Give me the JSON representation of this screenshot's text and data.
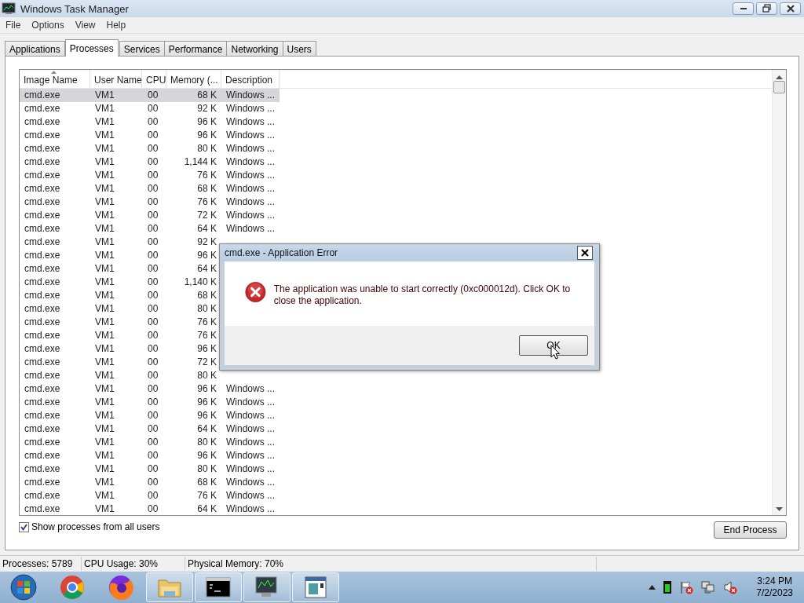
{
  "window": {
    "title": "Windows Task Manager"
  },
  "menu": [
    "File",
    "Options",
    "View",
    "Help"
  ],
  "tabs": [
    {
      "label": "Applications",
      "selected": false
    },
    {
      "label": "Processes",
      "selected": true
    },
    {
      "label": "Services",
      "selected": false
    },
    {
      "label": "Performance",
      "selected": false
    },
    {
      "label": "Networking",
      "selected": false
    },
    {
      "label": "Users",
      "selected": false
    }
  ],
  "table": {
    "columns": [
      "Image Name",
      "User Name",
      "CPU",
      "Memory (...",
      "Description"
    ],
    "rows": [
      {
        "image_name": "cmd.exe",
        "user_name": "VM1",
        "cpu": "00",
        "memory": "68 K",
        "description": "Windows ...",
        "selected": true
      },
      {
        "image_name": "cmd.exe",
        "user_name": "VM1",
        "cpu": "00",
        "memory": "92 K",
        "description": "Windows ...",
        "selected": false
      },
      {
        "image_name": "cmd.exe",
        "user_name": "VM1",
        "cpu": "00",
        "memory": "96 K",
        "description": "Windows ...",
        "selected": false
      },
      {
        "image_name": "cmd.exe",
        "user_name": "VM1",
        "cpu": "00",
        "memory": "96 K",
        "description": "Windows ...",
        "selected": false
      },
      {
        "image_name": "cmd.exe",
        "user_name": "VM1",
        "cpu": "00",
        "memory": "80 K",
        "description": "Windows ...",
        "selected": false
      },
      {
        "image_name": "cmd.exe",
        "user_name": "VM1",
        "cpu": "00",
        "memory": "1,144 K",
        "description": "Windows ...",
        "selected": false
      },
      {
        "image_name": "cmd.exe",
        "user_name": "VM1",
        "cpu": "00",
        "memory": "76 K",
        "description": "Windows ...",
        "selected": false
      },
      {
        "image_name": "cmd.exe",
        "user_name": "VM1",
        "cpu": "00",
        "memory": "68 K",
        "description": "Windows ...",
        "selected": false
      },
      {
        "image_name": "cmd.exe",
        "user_name": "VM1",
        "cpu": "00",
        "memory": "76 K",
        "description": "Windows ...",
        "selected": false
      },
      {
        "image_name": "cmd.exe",
        "user_name": "VM1",
        "cpu": "00",
        "memory": "72 K",
        "description": "Windows ...",
        "selected": false
      },
      {
        "image_name": "cmd.exe",
        "user_name": "VM1",
        "cpu": "00",
        "memory": "64 K",
        "description": "Windows ...",
        "selected": false
      },
      {
        "image_name": "cmd.exe",
        "user_name": "VM1",
        "cpu": "00",
        "memory": "92 K",
        "selected": false
      },
      {
        "image_name": "cmd.exe",
        "user_name": "VM1",
        "cpu": "00",
        "memory": "96 K",
        "selected": false
      },
      {
        "image_name": "cmd.exe",
        "user_name": "VM1",
        "cpu": "00",
        "memory": "64 K",
        "selected": false
      },
      {
        "image_name": "cmd.exe",
        "user_name": "VM1",
        "cpu": "00",
        "memory": "1,140 K",
        "selected": false
      },
      {
        "image_name": "cmd.exe",
        "user_name": "VM1",
        "cpu": "00",
        "memory": "68 K",
        "selected": false
      },
      {
        "image_name": "cmd.exe",
        "user_name": "VM1",
        "cpu": "00",
        "memory": "80 K",
        "selected": false
      },
      {
        "image_name": "cmd.exe",
        "user_name": "VM1",
        "cpu": "00",
        "memory": "76 K",
        "selected": false
      },
      {
        "image_name": "cmd.exe",
        "user_name": "VM1",
        "cpu": "00",
        "memory": "76 K",
        "selected": false
      },
      {
        "image_name": "cmd.exe",
        "user_name": "VM1",
        "cpu": "00",
        "memory": "96 K",
        "selected": false
      },
      {
        "image_name": "cmd.exe",
        "user_name": "VM1",
        "cpu": "00",
        "memory": "72 K",
        "selected": false
      },
      {
        "image_name": "cmd.exe",
        "user_name": "VM1",
        "cpu": "00",
        "memory": "80 K",
        "selected": false
      },
      {
        "image_name": "cmd.exe",
        "user_name": "VM1",
        "cpu": "00",
        "memory": "96 K",
        "description": "Windows ...",
        "selected": false
      },
      {
        "image_name": "cmd.exe",
        "user_name": "VM1",
        "cpu": "00",
        "memory": "96 K",
        "description": "Windows ...",
        "selected": false
      },
      {
        "image_name": "cmd.exe",
        "user_name": "VM1",
        "cpu": "00",
        "memory": "96 K",
        "description": "Windows ...",
        "selected": false
      },
      {
        "image_name": "cmd.exe",
        "user_name": "VM1",
        "cpu": "00",
        "memory": "64 K",
        "description": "Windows ...",
        "selected": false
      },
      {
        "image_name": "cmd.exe",
        "user_name": "VM1",
        "cpu": "00",
        "memory": "80 K",
        "description": "Windows ...",
        "selected": false
      },
      {
        "image_name": "cmd.exe",
        "user_name": "VM1",
        "cpu": "00",
        "memory": "96 K",
        "description": "Windows ...",
        "selected": false
      },
      {
        "image_name": "cmd.exe",
        "user_name": "VM1",
        "cpu": "00",
        "memory": "80 K",
        "description": "Windows ...",
        "selected": false
      },
      {
        "image_name": "cmd.exe",
        "user_name": "VM1",
        "cpu": "00",
        "memory": "68 K",
        "description": "Windows ...",
        "selected": false
      },
      {
        "image_name": "cmd.exe",
        "user_name": "VM1",
        "cpu": "00",
        "memory": "76 K",
        "description": "Windows ...",
        "selected": false
      },
      {
        "image_name": "cmd.exe",
        "user_name": "VM1",
        "cpu": "00",
        "memory": "64 K",
        "description": "Windows ...",
        "selected": false
      }
    ]
  },
  "show_all_users": {
    "label": "Show processes from all users",
    "checked": true
  },
  "end_process_button": "End Process",
  "status_bar": [
    "Processes: 5789",
    "CPU Usage: 30%",
    "Physical Memory: 70%"
  ],
  "dialog": {
    "title": "cmd.exe - Application Error",
    "message": "The application was unable to start correctly (0xc000012d). Click OK to close the application.",
    "button": "OK"
  },
  "taskbar": {
    "items": [
      {
        "kind": "start",
        "running": false
      },
      {
        "kind": "chrome",
        "running": false
      },
      {
        "kind": "firefox",
        "running": false
      },
      {
        "kind": "folder",
        "running": true
      },
      {
        "kind": "terminal",
        "running": true
      },
      {
        "kind": "monitor",
        "running": true
      },
      {
        "kind": "window",
        "running": true
      }
    ],
    "clock": {
      "time": "3:24 PM",
      "date": "7/2/2023"
    }
  }
}
